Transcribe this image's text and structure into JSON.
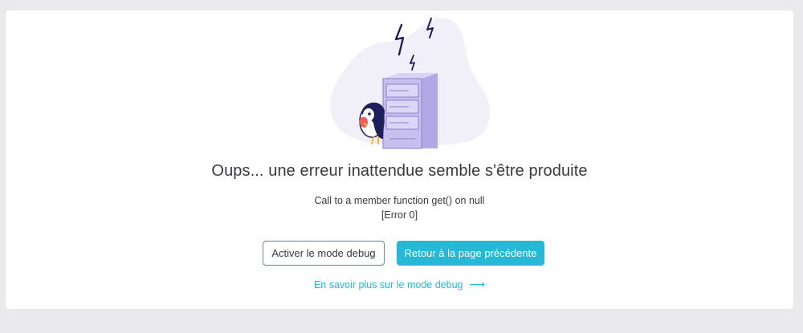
{
  "error": {
    "title": "Oups... une erreur inattendue semble s'être produite",
    "message": "Call to a member function get() on null",
    "code": "[Error 0]"
  },
  "actions": {
    "debug_button": "Activer le mode debug",
    "back_button": "Retour à la page précédente",
    "learn_more_link": "En savoir plus sur le mode debug",
    "learn_more_arrow": "⟶"
  },
  "colors": {
    "accent": "#25b9d7",
    "text": "#363a41",
    "blob": "#f1eff7",
    "server": "#c7bff0"
  },
  "icons": {
    "illustration": "server-error-illustration",
    "arrow": "arrow-right-icon"
  }
}
